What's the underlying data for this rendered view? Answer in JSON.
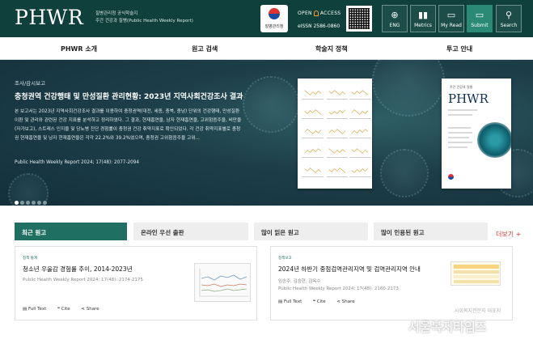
{
  "header": {
    "logo": "PHWR",
    "subtitle_line1": "질병관리청 공식학술지",
    "subtitle_line2": "주간 건강과 질병(Public Health Weekly Report)",
    "kdca_label": "질병관리청",
    "open_label": "OPEN",
    "access_label": "ACCESS",
    "issn": "eISSN 2586-0860",
    "buttons": [
      {
        "label": "ENG",
        "icon": "globe-icon",
        "glyph": "⊕"
      },
      {
        "label": "Metrics",
        "icon": "bar-chart-icon",
        "glyph": "▮▮"
      },
      {
        "label": "My Read",
        "icon": "bookmark-icon",
        "glyph": "▭"
      },
      {
        "label": "Submit",
        "icon": "monitor-icon",
        "glyph": "▭"
      },
      {
        "label": "Search",
        "icon": "search-icon",
        "glyph": "⚲"
      }
    ]
  },
  "nav": [
    "PHWR 소개",
    "원고 검색",
    "학술지 정책",
    "투고 안내"
  ],
  "hero": {
    "category": "조사/감시보고",
    "title": "충청권역 건강행태 및 만성질환 관리현황: 2023년 지역사회건강조사 결과",
    "body": "본 보고서는 2023년 지역사회건강조사 결과를 이용하여 충청권역(대전, 세종, 충북, 충남) 단위의 건강행태, 만성질환 이환 및 관리와 관련된 건강 지표를 분석하고 정리하였다. 그 결과, 현재흡연율, 남자 현재흡연율, 고위험음주율, 비만율(자가보고), 스트레스 인지율 및 당뇨병 진단 경험률이 충청권 건강 취약지표로 확인되었다. 각 건강 취약지표별로 충청권 현재흡연율 및 남자 현재흡연율은 각각 22.2%와 39.2%였으며, 충청권 고위험음주율 고위...",
    "reference": "Public Health Weekly Report 2024; 17(48): 2077-2094",
    "slide_count": 6,
    "active_slide": 0,
    "cover": {
      "top_text": "주간 건강과 질병",
      "logo": "PHWR"
    }
  },
  "tabs": [
    "최근 원고",
    "온라인 우선 출판",
    "많이 읽은 원고",
    "많이 인용된 원고"
  ],
  "more_label": "더보기 +",
  "cards": [
    {
      "category": "정책 통계",
      "title": "청소년 우울감 경험률 추이, 2014-2023년",
      "authors": "",
      "reference": "Public Health Weekly Report 2024; 17(48): 2174-2175",
      "actions": [
        "Full Text",
        "Cite",
        "Share"
      ]
    },
    {
      "category": "정책보고",
      "title": "2024년 하반기 중점검역관리지역 및 검역관리지역 안내",
      "authors": "임승주, 김승현, 김옥수",
      "reference": "Public Health Weekly Report 2024; 17(48): 2160-2173",
      "actions": [
        "Full Text",
        "Cite",
        "Share"
      ]
    }
  ],
  "watermark": "서울복지타임즈",
  "watermark_sub": "사회복지전문지 대표지",
  "colors": {
    "header": "#10403c",
    "accent": "#1f6f62",
    "more": "#d3342c"
  }
}
